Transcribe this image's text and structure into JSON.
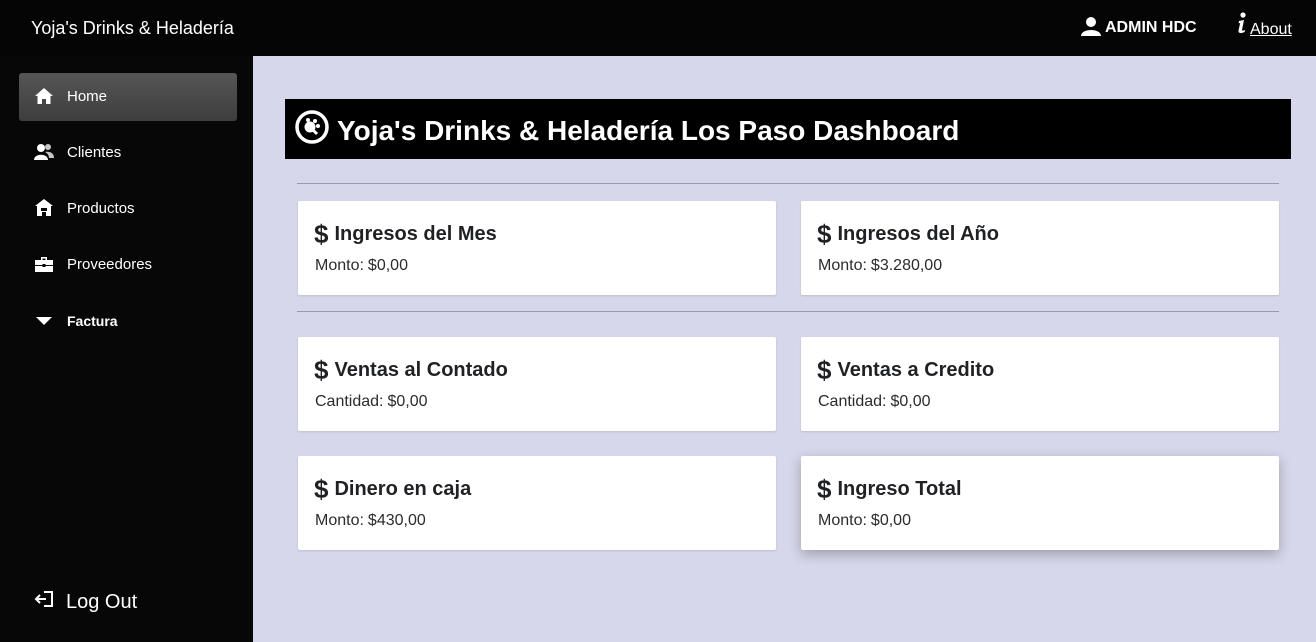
{
  "topbar": {
    "brand": "Yoja's Drinks & Heladería",
    "user_label": "ADMIN HDC",
    "about_label": "About"
  },
  "sidebar": {
    "items": [
      {
        "label": "Home",
        "icon": "home-icon",
        "active": true
      },
      {
        "label": "Clientes",
        "icon": "users-icon"
      },
      {
        "label": "Productos",
        "icon": "store-icon"
      },
      {
        "label": "Proveedores",
        "icon": "briefcase-icon"
      },
      {
        "label": "Factura",
        "icon": "caret-down-icon"
      }
    ],
    "logout_label": "Log Out"
  },
  "dashboard": {
    "title": "Yoja's Drinks & Heladería Los Paso Dashboard",
    "currency_symbol": "$",
    "cards": [
      {
        "title": "Ingresos del Mes",
        "label": "Monto:",
        "value": "$0,00"
      },
      {
        "title": "Ingresos del Año",
        "label": "Monto:",
        "value": "$3.280,00"
      },
      {
        "title": "Ventas al Contado",
        "label": "Cantidad:",
        "value": "$0,00"
      },
      {
        "title": "Ventas a Credito",
        "label": "Cantidad:",
        "value": "$0,00"
      },
      {
        "title": "Dinero en caja",
        "label": "Monto:",
        "value": "$430,00"
      },
      {
        "title": "Ingreso Total",
        "label": "Monto:",
        "value": "$0,00"
      }
    ]
  },
  "colors": {
    "background": "#d6d7ea",
    "sidebar": "#070707",
    "topbar": "#050505",
    "active_item": "#4a4a4a",
    "card": "#ffffff"
  }
}
